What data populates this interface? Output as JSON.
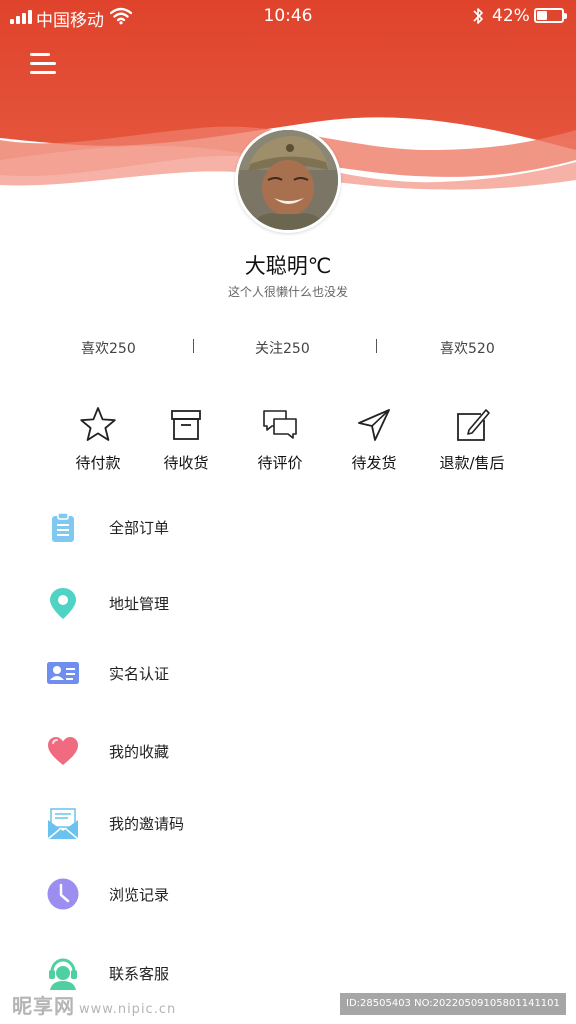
{
  "status_bar": {
    "carrier": "中国移动",
    "time": "10:46",
    "battery_percent_text": "42%",
    "battery_level": 0.42
  },
  "profile": {
    "name": "大聪明℃",
    "bio": "这个人很懒什么也没发"
  },
  "stats": [
    {
      "label": "喜欢250"
    },
    {
      "label": "关注250"
    },
    {
      "label": "喜欢520"
    }
  ],
  "orders": [
    {
      "label": "待付款",
      "icon": "star-icon"
    },
    {
      "label": "待收货",
      "icon": "box-icon"
    },
    {
      "label": "待评价",
      "icon": "chat-bubbles-icon"
    },
    {
      "label": "待发货",
      "icon": "paper-plane-icon"
    },
    {
      "label": "退款/售后",
      "icon": "edit-icon"
    }
  ],
  "menu": [
    {
      "label": "全部订单",
      "icon": "clipboard-icon",
      "color": "#7fc8f0"
    },
    {
      "label": "地址管理",
      "icon": "location-pin-icon",
      "color": "#4ed3c4"
    },
    {
      "label": "实名认证",
      "icon": "id-card-icon",
      "color": "#6f8ef0"
    },
    {
      "label": "我的收藏",
      "icon": "heart-icon",
      "color": "#f06b80"
    },
    {
      "label": "我的邀请码",
      "icon": "envelope-icon",
      "color": "#6bc2ee"
    },
    {
      "label": "浏览记录",
      "icon": "clock-icon",
      "color": "#9b8ef0"
    },
    {
      "label": "联系客服",
      "icon": "headset-icon",
      "color": "#4fd0a0"
    }
  ],
  "colors": {
    "header_red": "#e0432c",
    "header_red_light": "#ee7a66"
  },
  "watermark": {
    "left_logo": "昵享网",
    "left_url": "www.nipic.cn",
    "right_text": "ID:28505403 NO:20220509105801141101"
  }
}
